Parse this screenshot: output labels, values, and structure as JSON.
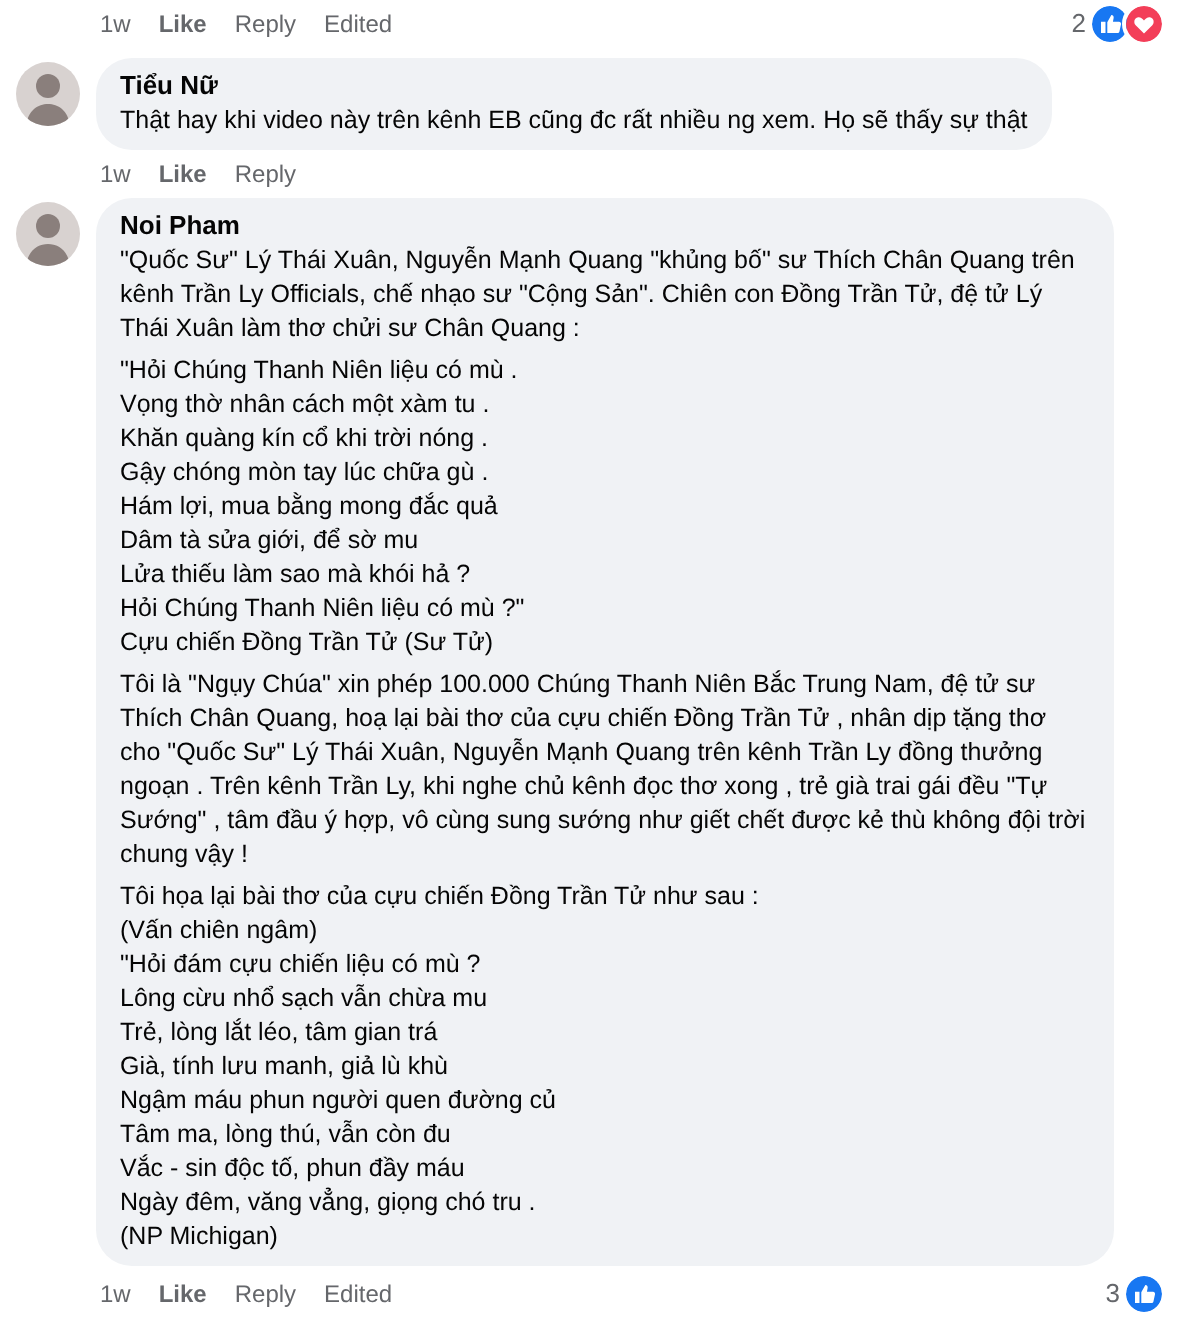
{
  "comments": [
    {
      "actions": {
        "time": "1w",
        "like": "Like",
        "reply": "Reply",
        "edited": "Edited"
      },
      "reactions": {
        "count": "2",
        "icons": [
          {
            "kind": "like"
          },
          {
            "kind": "love"
          }
        ]
      }
    },
    {
      "author": "Tiểu Nữ",
      "blocks": [
        [
          "Thật hay khi video này trên kênh EB cũng đc rất nhiều ng xem. Họ sẽ thấy sự thật"
        ]
      ],
      "actions": {
        "time": "1w",
        "like": "Like",
        "reply": "Reply"
      }
    },
    {
      "author": "Noi Pham",
      "blocks": [
        [
          "\"Quốc Sư\" Lý Thái Xuân, Nguyễn Mạnh Quang \"khủng bố\" sư Thích Chân Quang trên kênh Trần Ly Officials, chế nhạo sư \"Cộng Sản\". Chiên con Đồng Trần Tử, đệ tử Lý Thái Xuân làm thơ chửi sư Chân Quang :"
        ],
        [
          "\"Hỏi Chúng Thanh Niên liệu có mù .",
          "Vọng thờ nhân cách một xàm tu .",
          "Khăn quàng kín cổ khi trời nóng .",
          "Gậy chóng mòn tay lúc chữa gù .",
          "Hám lợi, mua bằng mong đắc quả",
          "Dâm tà sửa giới, để sờ mu",
          "Lửa thiếu làm sao mà khói hả ?",
          "Hỏi Chúng Thanh Niên liệu có mù ?\"",
          "Cựu chiến Đồng Trần Tử (Sư Tử)"
        ],
        [
          "Tôi là \"Ngụy Chúa\" xin phép 100.000 Chúng Thanh Niên Bắc Trung Nam, đệ tử sư Thích Chân Quang, hoạ lại bài thơ của cựu chiến Đồng Trần Tử , nhân dịp tặng thơ cho \"Quốc Sư\" Lý Thái Xuân, Nguyễn Mạnh Quang trên kênh Trần Ly đồng thưởng ngoạn . Trên kênh Trần Ly, khi nghe chủ kênh đọc thơ xong , trẻ già trai gái đều \"Tự Sướng\" , tâm đầu ý hợp, vô cùng sung sướng như giết chết được kẻ thù không đội trời chung vậy !"
        ],
        [
          "Tôi họa lại bài thơ của cựu chiến Đồng Trần Tử như sau :",
          "(Vấn chiên ngâm)",
          "\"Hỏi đám cựu chiến liệu có mù ?",
          "Lông cừu nhổ sạch vẫn chừa mu",
          "Trẻ, lòng lắt léo, tâm gian trá",
          "Già, tính lưu manh, giả lù khù",
          "Ngậm máu phun người quen đường củ",
          "Tâm ma, lòng thú, vẫn còn đu",
          "Vắc - sin độc tố, phun đầy máu",
          "Ngày đêm, văng vẳng, giọng chó tru .",
          "(NP Michigan)"
        ]
      ],
      "actions": {
        "time": "1w",
        "like": "Like",
        "reply": "Reply",
        "edited": "Edited"
      },
      "reactions": {
        "count": "3",
        "icons": [
          {
            "kind": "like"
          }
        ]
      }
    }
  ]
}
